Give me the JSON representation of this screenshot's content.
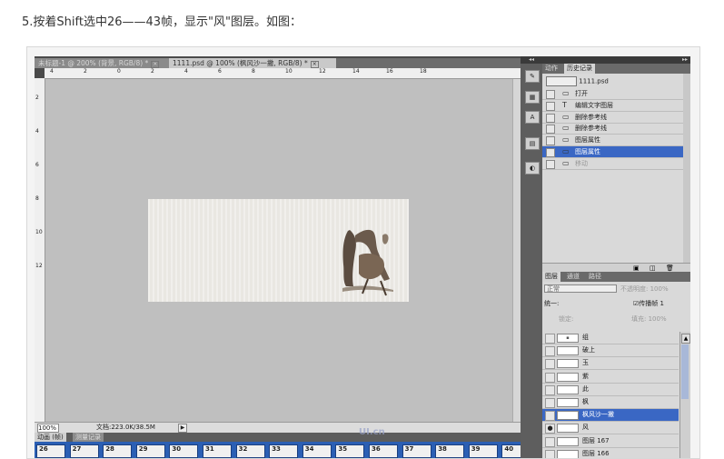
{
  "caption": "5.按着Shift选中26——43帧，显示\"风\"图层。如图：",
  "editor": {
    "tabs": [
      {
        "label": "未标题-1 @ 200% (背景, RGB/8) *",
        "close": "×"
      },
      {
        "label": "1111.psd @ 100% (枫风沙一撇, RGB/8) *",
        "close": "×"
      }
    ],
    "ruler_h": [
      "2",
      "4",
      "6",
      "8",
      "10",
      "12",
      "14",
      "16",
      "18"
    ],
    "ruler_h_left": [
      "4",
      "2",
      "0",
      "2",
      "4",
      "6",
      "8"
    ],
    "ruler_v": [
      "2",
      "4",
      "6",
      "8",
      "10",
      "12"
    ],
    "status": {
      "zoom": "100%",
      "doc": "文档:223.0K/38.5M",
      "arrow": "▶"
    },
    "anim_tabs": [
      "动画 (帧)",
      "测量记录"
    ],
    "frames": [
      "26",
      "27",
      "28",
      "29",
      "30",
      "31",
      "32",
      "33",
      "34",
      "35",
      "36",
      "37",
      "38",
      "39",
      "40"
    ],
    "watermark": "UI.cn"
  },
  "strip": {
    "collapse": "◂◂",
    "icons": [
      "history-brush-icon",
      "character-icon",
      "brush-icon",
      "swatch-icon",
      "mask-icon"
    ],
    "glyphs": [
      "✎",
      "▦",
      "A",
      "▤",
      "◐"
    ]
  },
  "right_panel": {
    "collapse": "▸▸",
    "history": {
      "tabs": [
        "动作",
        "历史记录"
      ],
      "snapshot": "1111.psd",
      "items": [
        {
          "icon": "▭",
          "label": "打开",
          "state": "normal"
        },
        {
          "icon": "T",
          "label": "编辑文字图层",
          "state": "normal"
        },
        {
          "icon": "▭",
          "label": "删除参考线",
          "state": "normal"
        },
        {
          "icon": "▭",
          "label": "删除参考线",
          "state": "normal"
        },
        {
          "icon": "▭",
          "label": "图层属性",
          "state": "normal"
        },
        {
          "icon": "▭",
          "label": "图层属性",
          "state": "selected"
        },
        {
          "icon": "▭",
          "label": "移动",
          "state": "dim"
        }
      ],
      "footer": [
        "▣",
        "◫",
        "🗑"
      ]
    },
    "layers": {
      "tabs": [
        "图层",
        "通道",
        "路径"
      ],
      "blend": "正常",
      "opacity_label": "不透明度: 100%",
      "unify_label": "统一: ",
      "propagate": "☑传播帧 1",
      "lock_label": "锁定:",
      "fill_label": "填充: 100%",
      "items": [
        {
          "name": "组",
          "thumb": "▪",
          "state": "normal"
        },
        {
          "name": "破上",
          "thumb": "",
          "state": "normal"
        },
        {
          "name": "玉",
          "thumb": "",
          "state": "normal"
        },
        {
          "name": "紫",
          "thumb": "",
          "state": "normal"
        },
        {
          "name": "此",
          "thumb": "",
          "state": "normal"
        },
        {
          "name": "枫",
          "thumb": "",
          "state": "normal"
        },
        {
          "name": "枫风沙一撇",
          "thumb": "",
          "state": "selected"
        },
        {
          "name": "风",
          "thumb": "",
          "state": "visible"
        },
        {
          "name": "图层 167",
          "thumb": "",
          "state": "normal"
        },
        {
          "name": "图层 166",
          "thumb": "",
          "state": "normal"
        }
      ]
    }
  }
}
